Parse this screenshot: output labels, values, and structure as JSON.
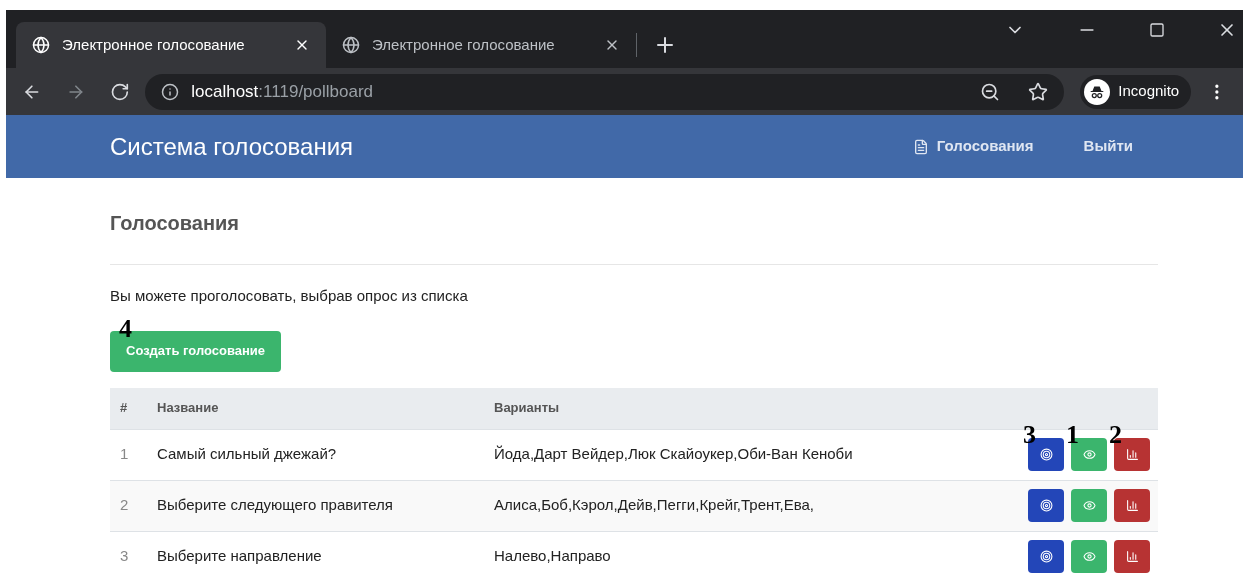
{
  "browser": {
    "tabs": [
      {
        "title": "Электронное голосование",
        "selected": true
      },
      {
        "title": "Электронное голосование",
        "selected": false
      }
    ],
    "url_host": "localhost",
    "url_path": ":1119/pollboard",
    "profile": "Incognito"
  },
  "navbar": {
    "brand": "Система голосования",
    "links": [
      {
        "label": "Голосования",
        "kind": "icon"
      },
      {
        "label": "Выйти",
        "kind": "plain"
      }
    ]
  },
  "page": {
    "title": "Голосования",
    "intro": "Вы можете проголосовать, выбрав опрос из списка",
    "create_button": {
      "label": "Создать голосование",
      "callout": "4"
    }
  },
  "table": {
    "columns": [
      "#",
      "Название",
      "Варианты"
    ],
    "rows": [
      {
        "num": "1",
        "name": "Самый сильный джежай?",
        "options": "Йода,Дарт Вейдер,Люк Скайоукер,Оби-Ван Кеноби",
        "actions": [
          {
            "kind": "vote",
            "callout": "3"
          },
          {
            "kind": "view",
            "callout": "1"
          },
          {
            "kind": "results",
            "callout": "2"
          }
        ]
      },
      {
        "num": "2",
        "name": "Выберите следующего правителя",
        "options": "Алиса,Боб,Кэрол,Дейв,Пегги,Крейг,Трент,Ева,",
        "actions": [
          {
            "kind": "vote"
          },
          {
            "kind": "view"
          },
          {
            "kind": "results"
          }
        ]
      },
      {
        "num": "3",
        "name": "Выберите направление",
        "options": "Налево,Направо",
        "actions": [
          {
            "kind": "vote"
          },
          {
            "kind": "view"
          },
          {
            "kind": "results"
          }
        ]
      }
    ]
  }
}
